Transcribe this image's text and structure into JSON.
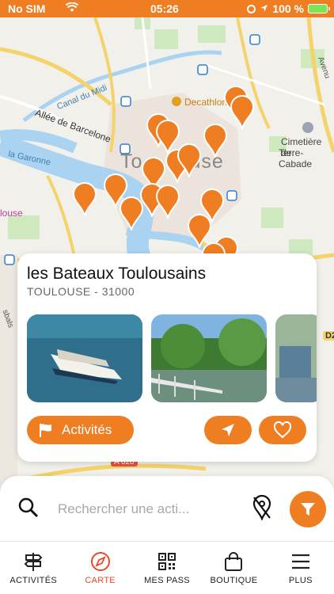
{
  "status_bar": {
    "carrier": "No SIM",
    "time": "05:26",
    "battery": "100 %"
  },
  "map": {
    "labels": {
      "canal": "Canal du Midi",
      "allee": "Allée de Barcelone",
      "garonne": "la Garonne",
      "decathlon": "Decathlon",
      "cemetery_1": "Cimetière de",
      "cemetery_2": "Terre-Cabade",
      "city_left": "To",
      "city_right": "louse",
      "louse_left": "louse",
      "road_a620": "A 620",
      "road_d2": "D2",
      "sbals": "sbals",
      "avenue": "Avenu"
    }
  },
  "card": {
    "title": "les Bateaux Toulousains",
    "subtitle": "TOULOUSE - 31000",
    "activites_label": "Activités"
  },
  "search": {
    "placeholder": "Rechercher une acti..."
  },
  "tabs": [
    {
      "label": "ACTIVITÉS",
      "icon": "signpost-icon",
      "active": false
    },
    {
      "label": "CARTE",
      "icon": "compass-icon",
      "active": true
    },
    {
      "label": "MES PASS",
      "icon": "qr-code-icon",
      "active": false
    },
    {
      "label": "BOUTIQUE",
      "icon": "shopping-bag-icon",
      "active": false
    },
    {
      "label": "PLUS",
      "icon": "menu-icon",
      "active": false
    }
  ],
  "colors": {
    "accent": "#ef7d22",
    "active_tab": "#e84a26"
  }
}
